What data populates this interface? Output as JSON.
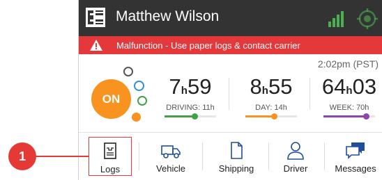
{
  "header": {
    "driver_name": "Matthew Wilson",
    "icons": [
      "eld-logo-icon",
      "signal-bars-icon",
      "gps-target-icon"
    ]
  },
  "banner": {
    "icon": "warning-triangle-icon",
    "text": "Malfunction - Use paper logs & contact carrier"
  },
  "status": {
    "time": "2:02pm (PST)",
    "duty_status": "ON",
    "clocks": [
      {
        "hours": "7",
        "minutes": "59",
        "unit": "h",
        "label": "DRIVING: 11h",
        "color": "#43a047",
        "progress": 0.58
      },
      {
        "hours": "8",
        "minutes": "55",
        "unit": "h",
        "label": "DAY: 14h",
        "color": "#f7931e",
        "progress": 0.55
      },
      {
        "hours": "64",
        "minutes": "03",
        "unit": "h",
        "label": "WEEK: 70h",
        "color": "#8e44ad",
        "progress": 0.82
      }
    ]
  },
  "tabs": [
    {
      "label": "Logs",
      "icon": "logbook-icon",
      "active": true
    },
    {
      "label": "Vehicle",
      "icon": "truck-icon",
      "active": false
    },
    {
      "label": "Shipping",
      "icon": "document-icon",
      "active": false
    },
    {
      "label": "Driver",
      "icon": "person-icon",
      "active": false
    },
    {
      "label": "Messages",
      "icon": "chat-bubbles-icon",
      "active": false
    }
  ],
  "callout": {
    "number": "1"
  },
  "colors": {
    "header_bg": "#333333",
    "banner_bg": "#e5383b",
    "on_status": "#f7931e",
    "accent_red": "#e53935",
    "bubble_gray": "#555555",
    "bubble_blue": "#2b8fd6",
    "bubble_green": "#43a047",
    "signal_green": "#4caf50"
  }
}
